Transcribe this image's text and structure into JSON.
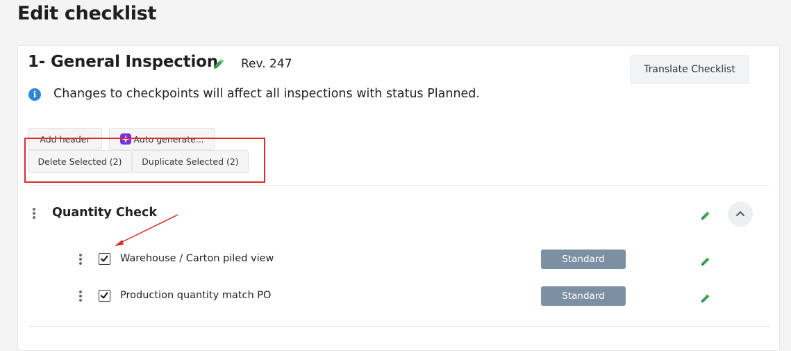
{
  "page": {
    "title": "Edit checklist"
  },
  "checklist": {
    "title": "1- General Inspection",
    "revision": "Rev. 247",
    "translate_label": "Translate Checklist",
    "info_text": "Changes to checkpoints will affect all inspections with status Planned."
  },
  "toolbar": {
    "add_header_label": "Add header",
    "auto_generate_label": "Auto generate...",
    "delete_selected_label": "Delete Selected (2)",
    "duplicate_selected_label": "Duplicate Selected (2)"
  },
  "section": {
    "title": "Quantity Check",
    "items": [
      {
        "label": "Warehouse / Carton piled view",
        "tag": "Standard",
        "checked": true
      },
      {
        "label": "Production quantity match PO",
        "tag": "Standard",
        "checked": true
      }
    ]
  },
  "colors": {
    "edit_icon": "#3ca35a",
    "info_icon": "#2f86d6",
    "badge": "#7d8fa3",
    "highlight": "#e02a2a",
    "auto_generate_icon": "#7b2fe0"
  },
  "icons": [
    "pencil-icon",
    "info-icon",
    "sparkle-icon",
    "drag-handle-icon",
    "chevron-up-icon",
    "checkmark-icon"
  ]
}
